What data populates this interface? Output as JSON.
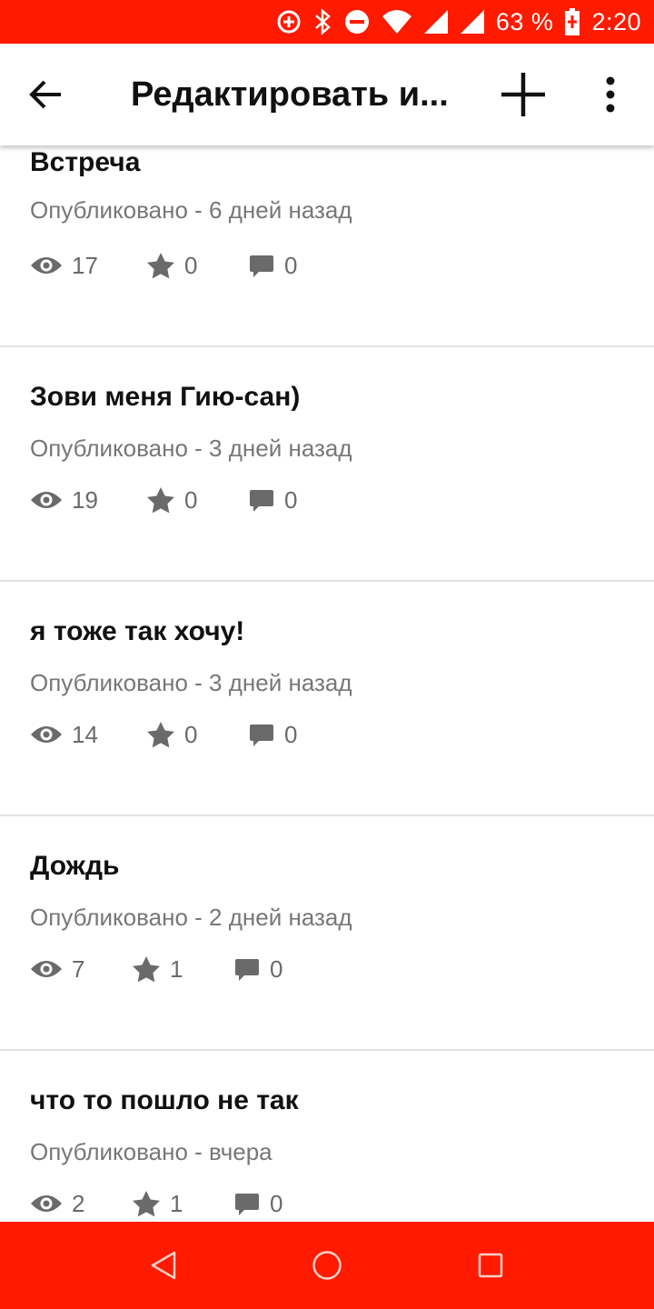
{
  "colors": {
    "accent": "#ff1a00",
    "icon_gray": "#6a6a6a",
    "text_gray": "#777777"
  },
  "status_bar": {
    "battery": "63 %",
    "time": "2:20",
    "icons": [
      "data-saver-icon",
      "bluetooth-icon",
      "do-not-disturb-icon",
      "wifi-icon",
      "signal-icon",
      "signal-icon",
      "battery-charging-icon"
    ]
  },
  "app_bar": {
    "title": "Редактировать и...",
    "back_icon": "arrow-back-icon",
    "add_icon": "plus-icon",
    "more_icon": "more-vert-icon"
  },
  "posts": [
    {
      "title": "Встреча",
      "published": "Опубликовано - 6 дней назад",
      "views": "17",
      "stars": "0",
      "comments": "0"
    },
    {
      "title": "Зови меня Гию-сан)",
      "published": "Опубликовано - 3 дней назад",
      "views": "19",
      "stars": "0",
      "comments": "0"
    },
    {
      "title": "я тоже так хочу!",
      "published": "Опубликовано - 3 дней назад",
      "views": "14",
      "stars": "0",
      "comments": "0"
    },
    {
      "title": "Дождь",
      "published": "Опубликовано - 2 дней назад",
      "views": "7",
      "stars": "1",
      "comments": "0"
    },
    {
      "title": "что то пошло не так",
      "published": "Опубликовано - вчера",
      "views": "2",
      "stars": "1",
      "comments": "0"
    }
  ],
  "nav_bar": {
    "icons": [
      "nav-back-icon",
      "nav-home-icon",
      "nav-recents-icon"
    ]
  }
}
